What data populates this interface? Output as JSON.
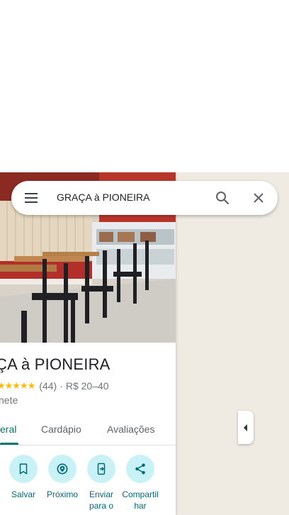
{
  "search": {
    "query": "GRAÇA à PIONEIRA"
  },
  "place": {
    "title": "ÇA à PIONEIRA",
    "rating_count": "(44)",
    "separator": "·",
    "price": "R$ 20–40",
    "category": "nete",
    "stars": "★★★★★"
  },
  "tabs": [
    {
      "label": "eral",
      "active": true
    },
    {
      "label": "Cardápio",
      "active": false
    },
    {
      "label": "Avaliações",
      "active": false
    }
  ],
  "actions": [
    {
      "label": "Salvar",
      "icon": "bookmark-icon"
    },
    {
      "label": "Próximo",
      "icon": "nearby-icon"
    },
    {
      "label": "Enviar para o",
      "icon": "send-to-phone-icon"
    },
    {
      "label": "Compartilhar",
      "icon": "share-icon"
    }
  ],
  "colors": {
    "accent": "#00796b",
    "action_bg": "#c9f2f6",
    "map_bg": "#efeae2",
    "star": "#fbbc04"
  }
}
